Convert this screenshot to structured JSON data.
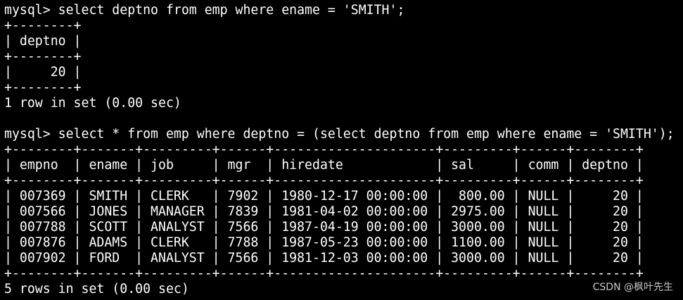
{
  "terminal": {
    "lines": [
      "mysql> select deptno from emp where ename = 'SMITH';",
      "+--------+",
      "| deptno |",
      "+--------+",
      "|     20 |",
      "+--------+",
      "1 row in set (0.00 sec)",
      "",
      "mysql> select * from emp where deptno = (select deptno from emp where ename = 'SMITH');",
      "+--------+-------+---------+------+---------------------+---------+------+--------+",
      "| empno  | ename | job     | mgr  | hiredate            | sal     | comm | deptno |",
      "+--------+-------+---------+------+---------------------+---------+------+--------+",
      "| 007369 | SMITH | CLERK   | 7902 | 1980-12-17 00:00:00 |  800.00 | NULL |     20 |",
      "| 007566 | JONES | MANAGER | 7839 | 1981-04-02 00:00:00 | 2975.00 | NULL |     20 |",
      "| 007788 | SCOTT | ANALYST | 7566 | 1987-04-19 00:00:00 | 3000.00 | NULL |     20 |",
      "| 007876 | ADAMS | CLERK   | 7788 | 1987-05-23 00:00:00 | 1100.00 | NULL |     20 |",
      "| 007902 | FORD  | ANALYST | 7566 | 1981-12-03 00:00:00 | 3000.00 | NULL |     20 |",
      "+--------+-------+---------+------+---------------------+---------+------+--------+",
      "5 rows in set (0.00 sec)"
    ]
  },
  "watermark": "CSDN @枫叶先生",
  "colors": {
    "background": "#000000",
    "foreground": "#ffffff"
  }
}
